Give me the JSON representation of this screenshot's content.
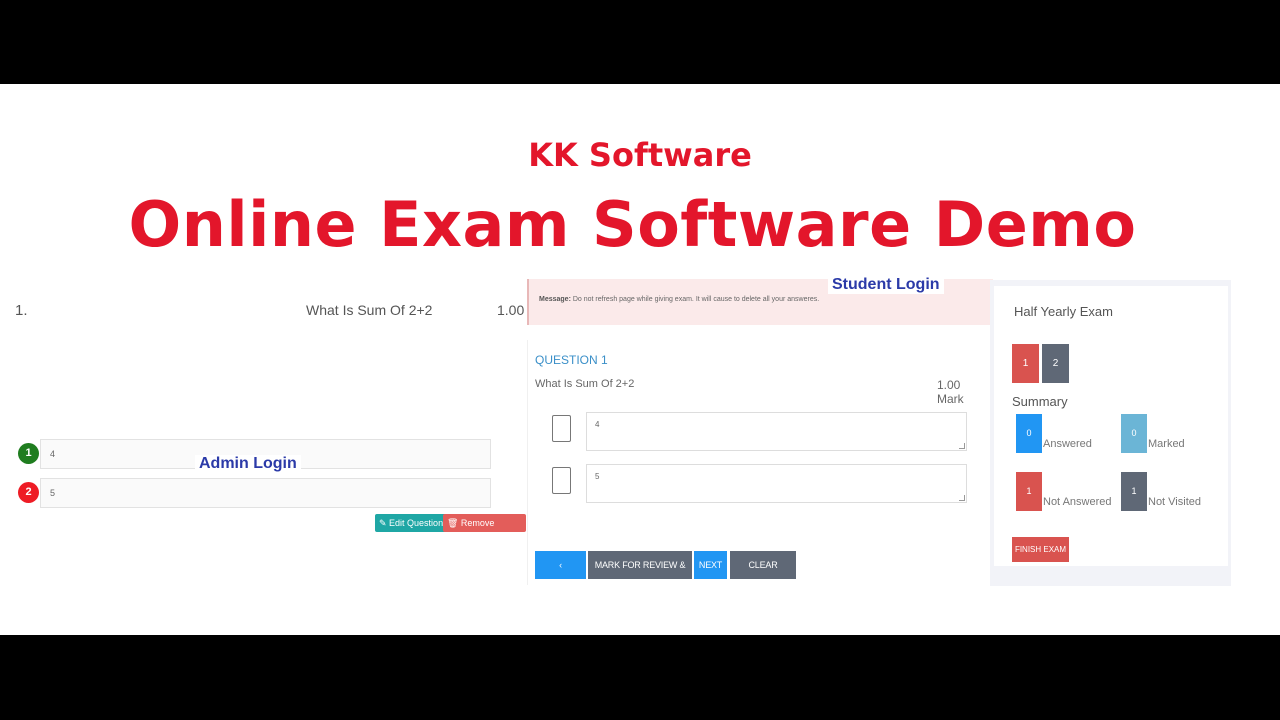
{
  "brand": "KK Software",
  "headline": "Online Exam Software Demo",
  "admin": {
    "label": "Admin Login",
    "question_number": "1.",
    "question_text": "What Is Sum Of 2+2",
    "marks": "1.00",
    "options": [
      {
        "badge": "1",
        "value": "4",
        "color": "#1f7d1f"
      },
      {
        "badge": "2",
        "value": "5",
        "color": "#ee1c25"
      }
    ],
    "edit_button": "✎ Edit Question",
    "remove_button": "🗑 Remove Question"
  },
  "student": {
    "label": "Student Login",
    "message_label": "Message:",
    "message_text": "Do not refresh page while giving exam. It will cause to delete all your answeres.",
    "question_title": "QUESTION 1",
    "question_text": "What Is Sum Of 2+2",
    "marks": "1.00 Mark",
    "answers": [
      "4",
      "5"
    ],
    "buttons": {
      "previous": "‹ PREVIOUS",
      "mark_review": "MARK FOR REVIEW & NEXT",
      "next": "NEXT ›",
      "clear": "CLEAR ANSWER"
    }
  },
  "sidebar": {
    "exam_name": "Half Yearly Exam",
    "palette": [
      {
        "label": "1",
        "color": "#d9534f"
      },
      {
        "label": "2",
        "color": "#5f6876"
      }
    ],
    "summary_title": "Summary",
    "summary": {
      "answered": {
        "count": "0",
        "label": "Answered",
        "color": "#2196f3"
      },
      "marked": {
        "count": "0",
        "label": "Marked",
        "color": "#6bb5d6"
      },
      "not_answered": {
        "count": "1",
        "label": "Not Answered",
        "color": "#d9534f"
      },
      "not_visited": {
        "count": "1",
        "label": "Not Visited",
        "color": "#5f6876"
      }
    },
    "finish_button": "FINISH EXAM"
  }
}
